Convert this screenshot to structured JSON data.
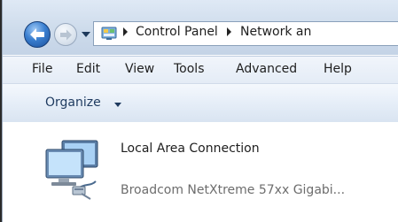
{
  "navbar": {
    "breadcrumb": [
      "Control Panel",
      "Network an"
    ]
  },
  "menu": {
    "items": [
      "File",
      "Edit",
      "View",
      "Tools",
      "Advanced",
      "Help"
    ]
  },
  "toolbar": {
    "organize_label": "Organize"
  },
  "connection": {
    "name": "Local Area Connection",
    "adapter": "Broadcom NetXtreme 57xx Gigabi..."
  },
  "colors": {
    "nav_background": "#cddbeb",
    "command_bar": "#e6eef8",
    "back_button": "#3a7fd0"
  },
  "icons": [
    "back-arrow-icon",
    "forward-arrow-icon",
    "control-panel-icon",
    "network-computers-icon"
  ]
}
